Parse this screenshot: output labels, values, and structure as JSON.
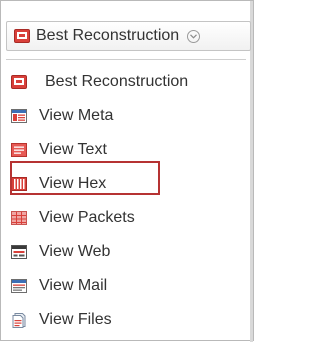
{
  "selector": {
    "selected_label": "Best Reconstruction",
    "icon": "best-reconstruction-icon",
    "chevron": "chevron-down-icon"
  },
  "menu": {
    "items": [
      {
        "label": "Best Reconstruction",
        "icon": "best-reconstruction-icon"
      },
      {
        "label": "View Meta",
        "icon": "meta-icon",
        "highlighted": true
      },
      {
        "label": "View Text",
        "icon": "text-icon"
      },
      {
        "label": "View Hex",
        "icon": "hex-icon"
      },
      {
        "label": "View Packets",
        "icon": "packets-icon"
      },
      {
        "label": "View Web",
        "icon": "web-icon"
      },
      {
        "label": "View Mail",
        "icon": "mail-icon"
      },
      {
        "label": "View Files",
        "icon": "files-icon"
      }
    ]
  },
  "colors": {
    "highlight_border": "#b63232",
    "icon_red": "#d9403a"
  }
}
